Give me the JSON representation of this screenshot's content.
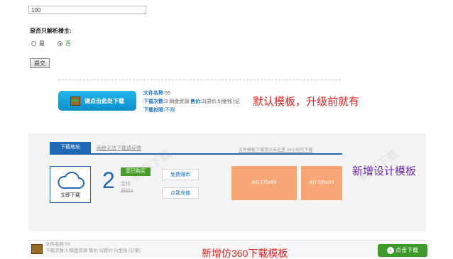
{
  "form": {
    "number_value": "100",
    "parse_owner_label": "是否只解析楼主:",
    "radio_yes": "是",
    "radio_no": "否",
    "submit_label": "提交"
  },
  "default_template": {
    "download_button": "请点击此处下载",
    "file_name_label": "文件名称:",
    "file_name_value": "55",
    "downloads_label": "下载次数:",
    "downloads_value": "3",
    "source": "网盘资源",
    "price_label": "售价:",
    "price_value": "2(原价:5)金钱 [记",
    "permission_label": "下载权限:",
    "permission_value": "不限",
    "note": "默认模板，升级前就有"
  },
  "new_template": {
    "tab_active": "下载地址",
    "tab_second": "网盘无法下载请反馈",
    "right_link": "文件模板下载请点击这里 24小时可下载",
    "cloud_label": "立即下载",
    "count": "2",
    "badge": "您已购买",
    "coin_label": "金钱",
    "orig_label": "原价5",
    "free_earn": "免费赚币",
    "recharge": "点我充值",
    "ad1": "AD:170x90",
    "ad2": "AD:105x90",
    "note": "新增设计模板"
  },
  "bottom_template": {
    "line1": "文件名称:55",
    "line2": "下载次数:3  网盘资源  售价:2(原价:5)金钱 [记录]",
    "download_button": "点击下载",
    "note": "新增仿360下载模板"
  }
}
